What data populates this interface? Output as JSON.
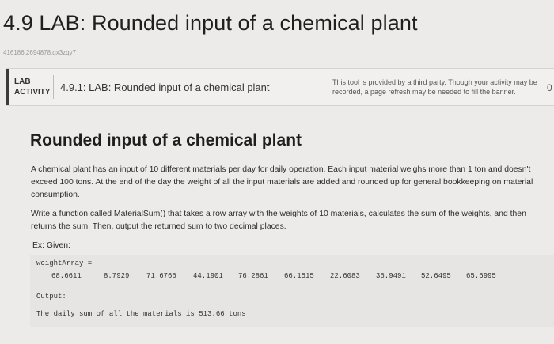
{
  "page": {
    "title": "4.9 LAB: Rounded input of a chemical plant",
    "id_text": "416186.2694878.qx3zqy7"
  },
  "lab_banner": {
    "tag_line1": "LAB",
    "tag_line2": "ACTIVITY",
    "name": "4.9.1: LAB: Rounded input of a chemical plant",
    "note": "This tool is provided by a third party. Though your activity may be recorded, a page refresh may be needed to fill the banner.",
    "score": "0"
  },
  "content": {
    "heading": "Rounded input of a chemical plant",
    "paragraph1": "A chemical plant has an input of 10 different materials per day for daily operation. Each input material weighs more than 1 ton and doesn't exceed 100 tons. At the end of the day the weight of all the input materials are added and rounded up for general bookkeeping on material consumption.",
    "paragraph2": "Write a function called MaterialSum() that takes a row array with the weights of 10 materials, calculates the sum of the weights, and then returns the sum. Then, output the returned sum to two decimal places.",
    "example_label": "Ex: Given:"
  },
  "code": {
    "array_decl": "weightArray =",
    "weights": [
      "68.6611",
      "8.7929",
      "71.6766",
      "44.1901",
      "76.2861",
      "66.1515",
      "22.6083",
      "36.9491",
      "52.6495",
      "65.6995"
    ],
    "output_label": "Output:",
    "output_text": "The daily sum of all the materials is 513.66 tons"
  }
}
